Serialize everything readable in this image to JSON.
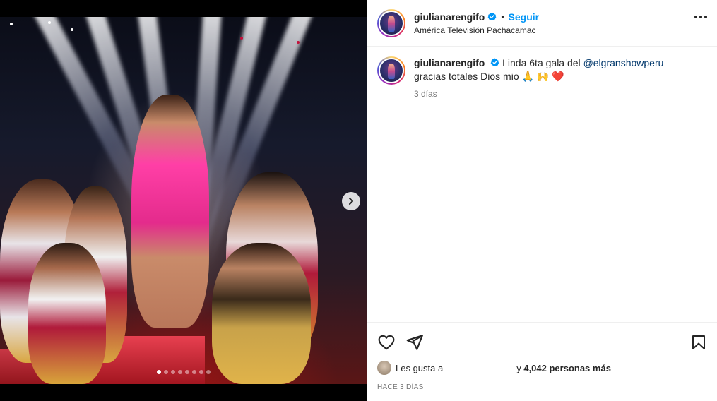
{
  "post": {
    "username": "giulianarengifo",
    "follow_label": "Seguir",
    "separator": "•",
    "location": "América Televisión Pachacamac",
    "caption": {
      "username": "giulianarengifo",
      "text_before": "Linda 6ta gala del ",
      "mention": "@elgranshowperu",
      "text_after": " gracias totales Dios mio 🙏 🙌 ❤️"
    },
    "time_ago": "3 días",
    "likes_prefix": "Les gusta a",
    "likes_connector": "y",
    "likes_count": "4,042 personas más",
    "date_label": "HACE 3 DÍAS"
  },
  "media": {
    "carousel_total": 8,
    "carousel_active": 1,
    "photo_subject": "dancers-on-stage"
  },
  "icons": {
    "verified": "verified-badge-icon",
    "more": "more-options-icon",
    "like": "heart-icon",
    "share": "send-icon",
    "save": "bookmark-icon",
    "next": "chevron-right-icon"
  },
  "colors": {
    "follow": "#0095f6",
    "verified": "#0095f6",
    "mention": "#00376b",
    "muted": "#737373"
  }
}
